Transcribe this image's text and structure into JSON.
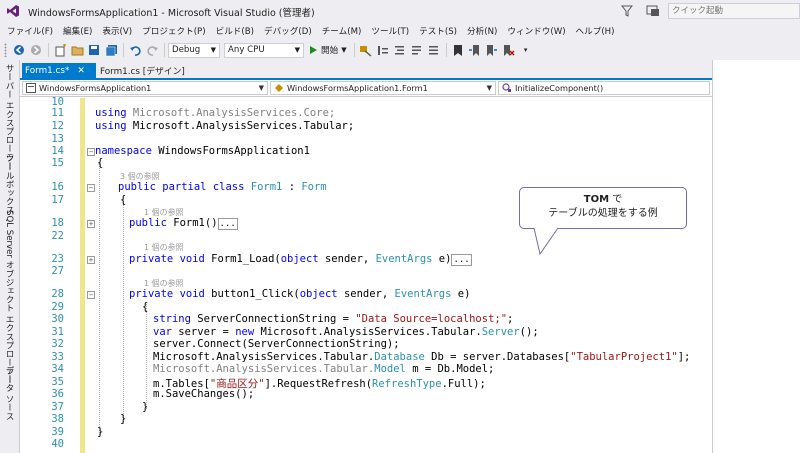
{
  "window": {
    "title": "WindowsFormsApplication1 - Microsoft Visual Studio (管理者)",
    "quick_launch_placeholder": "クイック起動"
  },
  "menu": [
    "ファイル(F)",
    "編集(E)",
    "表示(V)",
    "プロジェクト(P)",
    "ビルド(B)",
    "デバッグ(D)",
    "チーム(M)",
    "ツール(T)",
    "テスト(S)",
    "分析(N)",
    "ウィンドウ(W)",
    "ヘルプ(H)"
  ],
  "toolbar": {
    "config": "Debug",
    "platform": "Any CPU",
    "start_label": "開始"
  },
  "side_tabs": [
    "サーバー エクスプローラー",
    "ツールボックス",
    "SQL Server オブジェクト エクスプローラー",
    "データ ソース"
  ],
  "tabs": [
    {
      "label": "Form1.cs*",
      "active": true
    },
    {
      "label": "Form1.cs [デザイン]",
      "active": false
    }
  ],
  "nav": {
    "project": "WindowsFormsApplication1",
    "class": "WindowsFormsApplication1.Form1",
    "member": "InitializeComponent()"
  },
  "editor": {
    "line_numbers": [
      "10",
      "11",
      "12",
      "13",
      "14",
      "15",
      "16",
      "17",
      "18",
      "22",
      "23",
      "27",
      "28",
      "29",
      "30",
      "31",
      "32",
      "33",
      "34",
      "35",
      "36",
      "37",
      "38",
      "39",
      "40"
    ],
    "lens_ref3": "3 個の参照",
    "lens_ref1": "1 個の参照",
    "lines": {
      "l11_kw": "using",
      "l11_rest": " Microsoft.AnalysisServices.Core;",
      "l12_kw": "using",
      "l12_rest": " Microsoft.AnalysisServices.Tabular;",
      "l14_kw": "namespace",
      "l14_rest": " WindowsFormsApplication1",
      "l15": "{",
      "l16_kw": "public partial class",
      "l16_type": " Form1",
      "l16_sep": " : ",
      "l16_base": "Form",
      "l17": "{",
      "l18_kw": "public",
      "l18_rest": " Form1()",
      "collapsed": "...",
      "l23_kw": "private void",
      "l23_a": " Form1_Load(",
      "l23_kw2": "object",
      "l23_b": " sender, ",
      "l23_type": "EventArgs",
      "l23_c": " e)",
      "l28_kw": "private void",
      "l28_a": " button1_Click(",
      "l28_kw2": "object",
      "l28_b": " sender, ",
      "l28_type": "EventArgs",
      "l28_c": " e)",
      "l29": "{",
      "l30_kw": "string",
      "l30_a": " ServerConnectionString = ",
      "l30_str": "\"Data Source=localhost;\"",
      "l30_b": ";",
      "l31_kw": "var",
      "l31_a": " server = ",
      "l31_kw2": "new",
      "l31_b": " Microsoft.AnalysisServices.Tabular.",
      "l31_type": "Server",
      "l31_c": "();",
      "l32": "server.Connect(ServerConnectionString);",
      "l33_a": "Microsoft.AnalysisServices.Tabular.",
      "l33_type": "Database",
      "l33_b": " Db = server.Databases[",
      "l33_str": "\"TabularProject1\"",
      "l33_c": "];",
      "l34_gray": "Microsoft.AnalysisServices.Tabular.",
      "l34_type": "Model",
      "l34_b": " m = Db.Model;",
      "l35_a": "m.Tables[",
      "l35_str": "\"商品区分\"",
      "l35_b": "].RequestRefresh(",
      "l35_type": "RefreshType",
      "l35_c": ".Full);",
      "l36": "m.SaveChanges();",
      "l37": "}",
      "l38": "}",
      "l39": "}"
    }
  },
  "callout": {
    "bold": "TOM",
    "line1_rest": " で",
    "line2": "テーブルの処理をする例"
  }
}
